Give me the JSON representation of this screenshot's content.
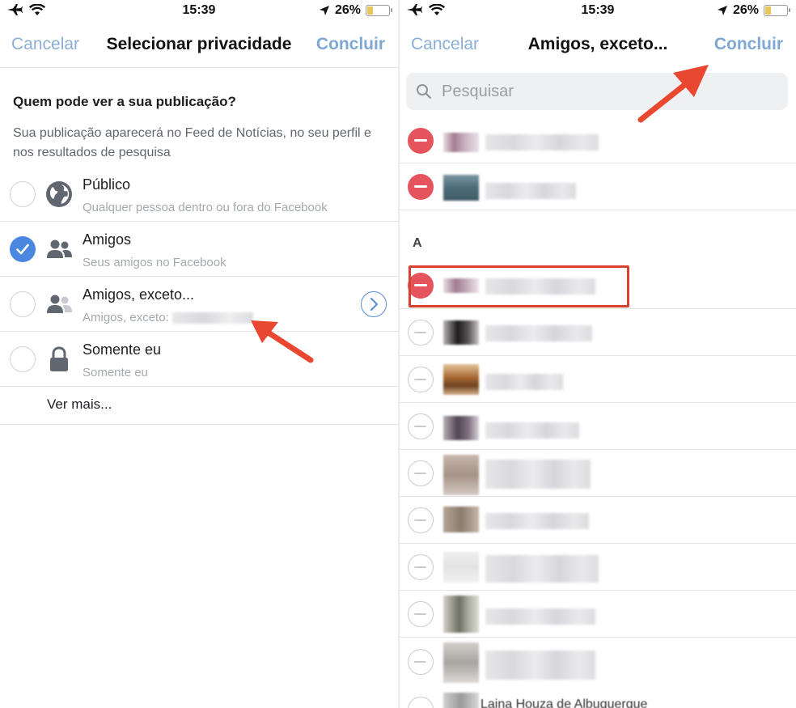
{
  "left_screen": {
    "status_bar": {
      "time": "15:39",
      "battery": "26%",
      "battery_level": 0.26
    },
    "nav": {
      "cancel_label": "Cancelar",
      "title": "Selecionar privacidade",
      "done_label": "Concluir"
    },
    "section_title": "Quem pode ver a sua publicação?",
    "section_description": "Sua publicação aparecerá no Feed de Notícias, no seu perfil e nos resultados de pesquisa",
    "options": [
      {
        "title": "Público",
        "subtitle": "Qualquer pessoa dentro ou fora do Facebook",
        "icon": "globe-icon",
        "selected": false
      },
      {
        "title": "Amigos",
        "subtitle": "Seus amigos no Facebook",
        "icon": "friends-icon",
        "selected": true
      },
      {
        "title": "Amigos, exceto...",
        "subtitle": "Amigos, exceto:",
        "icon": "friends-except-icon",
        "selected": false
      },
      {
        "title": "Somente eu",
        "subtitle": "Somente eu",
        "icon": "lock-icon",
        "selected": false
      }
    ],
    "see_more_label": "Ver mais..."
  },
  "right_screen": {
    "status_bar": {
      "time": "15:39",
      "battery": "26%",
      "battery_level": 0.26
    },
    "nav": {
      "cancel_label": "Cancelar",
      "title": "Amigos, exceto...",
      "done_label": "Concluir"
    },
    "search": {
      "placeholder": "Pesquisar"
    },
    "section_letter": "A",
    "partial_bottom_name": "Laina Houza de Albuquerque"
  },
  "colors": {
    "link_blue": "#8aaed6",
    "selected_blue": "#4a87e0",
    "remove_red": "#e5535d",
    "annotation_red": "#e9472f"
  }
}
